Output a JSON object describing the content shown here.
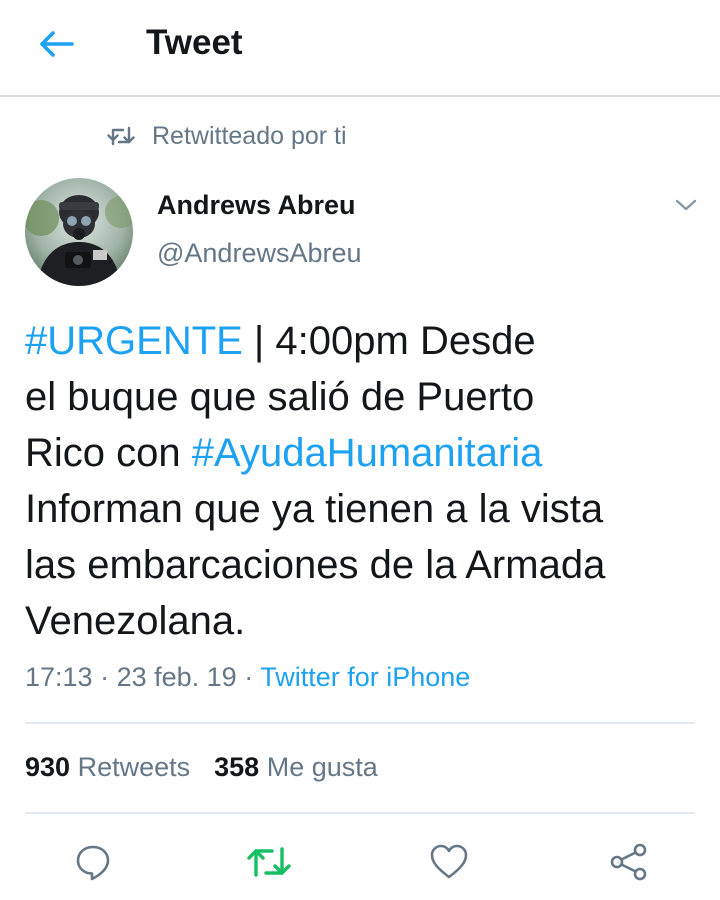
{
  "header": {
    "title": "Tweet",
    "back_icon": "arrow-left-icon",
    "accent": "#1da1f2"
  },
  "retweet_context": {
    "text": "Retwitteado por ti",
    "icon": "retweet-icon"
  },
  "author": {
    "name": "Andrews Abreu",
    "handle": "@AndrewsAbreu"
  },
  "tweet": {
    "lines": [
      [
        {
          "t": "#URGENTE",
          "tag": true
        },
        {
          "t": " | 4:00pm Desde",
          "tag": false
        }
      ],
      [
        {
          "t": "el buque que salió de Puerto",
          "tag": false
        }
      ],
      [
        {
          "t": "Rico con ",
          "tag": false
        },
        {
          "t": "#AyudaHumanitaria",
          "tag": true
        }
      ],
      [
        {
          "t": "Informan que ya tienen a la vista",
          "tag": false
        }
      ],
      [
        {
          "t": "las embarcaciones de la Armada",
          "tag": false
        }
      ],
      [
        {
          "t": "Venezolana.",
          "tag": false
        }
      ]
    ]
  },
  "meta": {
    "time": "17:13",
    "separator": " · ",
    "date": "23 feb. 19",
    "source": "Twitter for iPhone"
  },
  "stats": {
    "retweets_count": "930",
    "retweets_label": "Retweets",
    "likes_count": "358",
    "likes_label": "Me gusta"
  },
  "actions": [
    "reply-icon",
    "retweet-icon",
    "like-icon",
    "share-icon"
  ],
  "colors": {
    "link": "#1da1f2",
    "secondary_text": "#657786",
    "retweeted_green": "#17bf63",
    "action_gray": "#657786"
  }
}
